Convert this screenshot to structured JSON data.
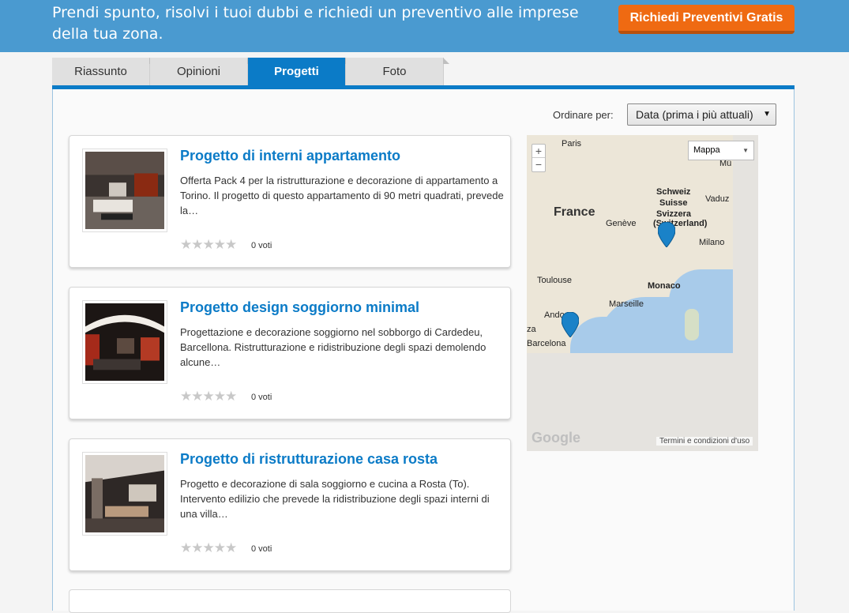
{
  "banner": {
    "text": "Prendi spunto, risolvi i tuoi dubbi e richiedi un preventivo alle imprese della tua zona.",
    "cta_label": "Richiedi Preventivi Gratis"
  },
  "tabs": [
    {
      "label": "Riassunto",
      "active": false
    },
    {
      "label": "Opinioni",
      "active": false
    },
    {
      "label": "Progetti",
      "active": true
    },
    {
      "label": "Foto",
      "active": false
    }
  ],
  "sort": {
    "label": "Ordinare per:",
    "selected": "Data (prima i più attuali)"
  },
  "projects": [
    {
      "title": "Progetto di interni appartamento",
      "description": "Offerta Pack 4 per la ristrutturazione e decorazione di appartamento a Torino. Il progetto di questo appartamento di 90 metri quadrati, prevede la…",
      "rating": 0,
      "votes": "0 voti"
    },
    {
      "title": "Progetto design soggiorno minimal",
      "description": "Progettazione e decorazione soggiorno nel sobborgo di Cardedeu, Barcellona. Ristrutturazione e ridistribuzione degli spazi demolendo alcune…",
      "rating": 0,
      "votes": "0 voti"
    },
    {
      "title": "Progetto di ristrutturazione casa rosta",
      "description": "Progetto e decorazione di sala soggiorno e cucina a Rosta (To). Intervento edilizio che prevede la ridistribuzione degli spazi interni di una villa…",
      "rating": 0,
      "votes": "0 voti"
    }
  ],
  "map": {
    "type_selector": "Mappa",
    "zoom_in": "+",
    "zoom_out": "−",
    "labels": {
      "paris": "Paris",
      "france": "France",
      "schweiz": "Schweiz",
      "suisse": "Suisse",
      "svizzera": "Svizzera",
      "switzerland": "(Switzerland)",
      "vaduz": "Vaduz",
      "geneve": "Genève",
      "milano": "Milano",
      "mu": "Mü",
      "toulouse": "Toulouse",
      "monaco": "Monaco",
      "marseille": "Marseille",
      "andorra": "Ando",
      "za": "za",
      "barcelona": "Barcelona"
    },
    "logo": "Google",
    "terms": "Termini e condizioni d'uso"
  },
  "colors": {
    "brand_blue": "#0b7bc7",
    "cta_orange": "#ef6a12",
    "banner_blue": "#4a9ad0"
  }
}
